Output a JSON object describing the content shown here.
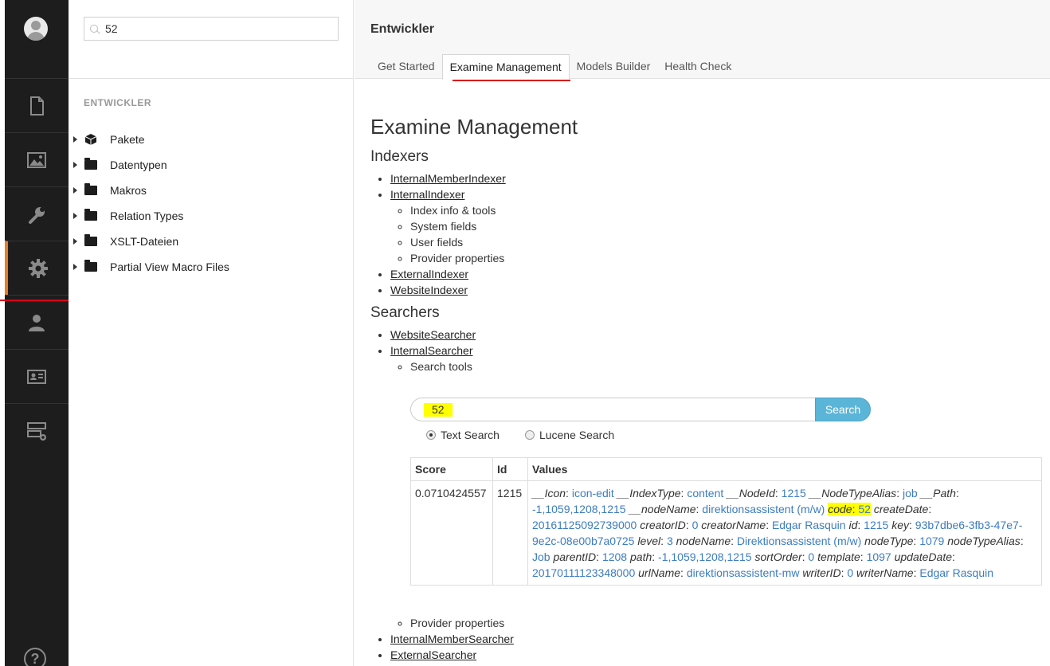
{
  "header": {
    "title": "Entwickler"
  },
  "tabs": [
    {
      "label": "Get Started"
    },
    {
      "label": "Examine Management"
    },
    {
      "label": "Models Builder"
    },
    {
      "label": "Health Check"
    }
  ],
  "tree": {
    "search_value": "52",
    "section_title": "ENTWICKLER",
    "items": [
      {
        "label": "Pakete"
      },
      {
        "label": "Datentypen"
      },
      {
        "label": "Makros"
      },
      {
        "label": "Relation Types"
      },
      {
        "label": "XSLT-Dateien"
      },
      {
        "label": "Partial View Macro Files"
      }
    ]
  },
  "sidebar": {
    "help": "?"
  },
  "main": {
    "heading": "Examine Management",
    "indexers_heading": "Indexers",
    "indexers": [
      "InternalMemberIndexer",
      "InternalIndexer",
      "ExternalIndexer",
      "WebsiteIndexer"
    ],
    "internal_indexer_sub": [
      "Index info & tools",
      "System fields",
      "User fields",
      "Provider properties"
    ],
    "searchers_heading": "Searchers",
    "searchers": [
      "WebsiteSearcher",
      "InternalSearcher",
      "InternalMemberSearcher",
      "ExternalSearcher"
    ],
    "search_tools": "Search tools",
    "provider_properties": "Provider properties",
    "search": {
      "value": "52",
      "button": "Search",
      "radio_text": "Text Search",
      "radio_lucene": "Lucene Search"
    },
    "results": {
      "headers": [
        "Score",
        "Id",
        "Values"
      ],
      "score": "0.0710424557",
      "id": "1215",
      "values": [
        {
          "k": "__Icon",
          "v": "icon-edit"
        },
        {
          "k": "__IndexType",
          "v": "content"
        },
        {
          "k": "__NodeId",
          "v": "1215"
        },
        {
          "k": "__NodeTypeAlias",
          "v": "job"
        },
        {
          "k": "__Path",
          "v": "-1,1059,1208,1215"
        },
        {
          "k": "__nodeName",
          "v": "direktionsassistent (m/w)"
        },
        {
          "k": "code",
          "v": "52",
          "highlight": true
        },
        {
          "k": "createDate",
          "v": "20161125092739000"
        },
        {
          "k": "creatorID",
          "v": "0"
        },
        {
          "k": "creatorName",
          "v": "Edgar Rasquin"
        },
        {
          "k": "id",
          "v": "1215"
        },
        {
          "k": "key",
          "v": "93b7dbe6-3fb3-47e7-9e2c-08e00b7a0725"
        },
        {
          "k": "level",
          "v": "3"
        },
        {
          "k": "nodeName",
          "v": "Direktionsassistent (m/w)"
        },
        {
          "k": "nodeType",
          "v": "1079"
        },
        {
          "k": "nodeTypeAlias",
          "v": "Job"
        },
        {
          "k": "parentID",
          "v": "1208"
        },
        {
          "k": "path",
          "v": "-1,1059,1208,1215"
        },
        {
          "k": "sortOrder",
          "v": "0"
        },
        {
          "k": "template",
          "v": "1097"
        },
        {
          "k": "updateDate",
          "v": "20170111123348000"
        },
        {
          "k": "urlName",
          "v": "direktionsassistent-mw"
        },
        {
          "k": "writerID",
          "v": "0"
        },
        {
          "k": "writerName",
          "v": "Edgar Rasquin"
        }
      ]
    }
  },
  "colors": {
    "sidebar_bg": "#1d1d1d",
    "active_accent": "#e67e22",
    "annotation_red": "#d9001b",
    "search_button": "#5bb5d8",
    "value_blue": "#3c7cc0",
    "highlight": "#ffff00"
  }
}
